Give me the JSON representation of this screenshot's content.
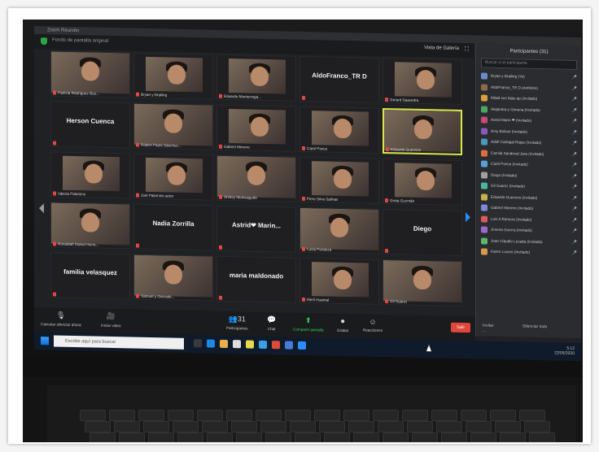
{
  "window": {
    "title": "Zoom Reunión"
  },
  "topbar": {
    "meeting_label": "Fondo de pantalla original",
    "view_label": "Vista de Galería"
  },
  "tiles": [
    {
      "kind": "video",
      "caption": "Patricia Rodríguez Bus..."
    },
    {
      "kind": "video",
      "caption": "Bryan y Brailing"
    },
    {
      "kind": "video",
      "caption": "Eduardo Monterroga..."
    },
    {
      "kind": "name",
      "name": "AldoFranco_TR D",
      "caption": ""
    },
    {
      "kind": "video",
      "caption": "Gerard Saavedra"
    },
    {
      "kind": "name",
      "name": "Herson Cuenca",
      "caption": ""
    },
    {
      "kind": "video",
      "caption": "Robert Paulo Sánchez..."
    },
    {
      "kind": "video",
      "caption": "Gabriel Moreno"
    },
    {
      "kind": "video",
      "caption": "Carol Ponce"
    },
    {
      "kind": "video",
      "caption": "Eduardo Guerrero",
      "active": true
    },
    {
      "kind": "video",
      "caption": "Valeria Palomino"
    },
    {
      "kind": "video",
      "caption": "Joel Palomino actor"
    },
    {
      "kind": "video",
      "caption": "Shirley Monteagudo"
    },
    {
      "kind": "video",
      "caption": "Piero Silva Salinas"
    },
    {
      "kind": "video",
      "caption": "Greta Guzmán"
    },
    {
      "kind": "video",
      "caption": "Ronaldaft Daniel Herre..."
    },
    {
      "kind": "name",
      "name": "Nadia Zorrilla",
      "caption": ""
    },
    {
      "kind": "name",
      "name": "Astrid❤ Marin...",
      "caption": ""
    },
    {
      "kind": "video",
      "caption": "Lucia Pendeza"
    },
    {
      "kind": "name",
      "name": "Diego",
      "caption": ""
    },
    {
      "kind": "name",
      "name": "familia velasquez",
      "caption": ""
    },
    {
      "kind": "video",
      "caption": "Samuel y Gonzalo..."
    },
    {
      "kind": "name",
      "name": "maria maldonado",
      "caption": ""
    },
    {
      "kind": "video",
      "caption": "Meril Huamal"
    },
    {
      "kind": "video",
      "caption": "Gil Suarez"
    }
  ],
  "toolbar": {
    "participants_label": "Participantes",
    "participants_count": "31",
    "chat_label": "Chat",
    "share_label": "Compartir pantalla",
    "record_label": "Grabar",
    "reactions_label": "Reacciones",
    "end_label": "Salir",
    "audio_label": "Cancelar silenciar ahora",
    "video_label": "Iniciar video"
  },
  "participants_panel": {
    "title": "Participantes (31)",
    "search_placeholder": "Buscar a un participante",
    "rows": [
      {
        "name": "Bryan y Brailing (Yo)",
        "color": "#6a8cc8"
      },
      {
        "name": "AldoFranco_TR D (Anfitrión)",
        "color": "#8a6a4a"
      },
      {
        "name": "Mitad sus hijas ap (Invitado)",
        "color": "#d8a040"
      },
      {
        "name": "Alejandra y Gimena (Invitado)",
        "color": "#4aa860"
      },
      {
        "name": "Astrid Marin ❤ (Invitado)",
        "color": "#c84a7a"
      },
      {
        "name": "Amy Bolivar (Invitado)",
        "color": "#8a5ab8"
      },
      {
        "name": "Adolf Carbajal Rojas (Invitado)",
        "color": "#4a9ab8"
      },
      {
        "name": "Camila Sandoval Jara (Invitado)",
        "color": "#d87040"
      },
      {
        "name": "Carol Ponce (Invitado)",
        "color": "#5aa0d8"
      },
      {
        "name": "Diego (Invitado)",
        "color": "#a0a0a0"
      },
      {
        "name": "Gil Suarez (Invitado)",
        "color": "#4ab8a0"
      },
      {
        "name": "Eduardo Guerrero (Invitado)",
        "color": "#c8b04a"
      },
      {
        "name": "Gabriel Moreno (Invitado)",
        "color": "#7a8ad8"
      },
      {
        "name": "Luis A Romero (Invitado)",
        "color": "#d85a5a"
      },
      {
        "name": "Jimena Guerra (Invitado)",
        "color": "#9a6ac8"
      },
      {
        "name": "Jean Claudio Lozada (Invitado)",
        "color": "#5ab86a"
      },
      {
        "name": "Karen Lucero (Invitado)",
        "color": "#d89a4a"
      }
    ],
    "invite_label": "Invitar",
    "mute_all_label": "Silenciar todo",
    "more_label": "..."
  },
  "taskbar": {
    "search_placeholder": "Escribe aquí para buscar",
    "time": "5:12",
    "date": "22/05/2020"
  },
  "colors": {
    "accent_green": "#2fd36b",
    "end_red": "#e0463b",
    "active_border": "#d8e84a",
    "nav_blue": "#2b8cff"
  }
}
